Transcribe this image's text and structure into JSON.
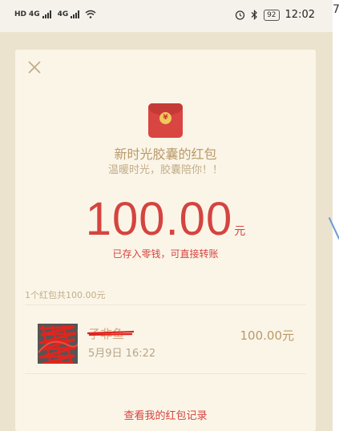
{
  "status_bar": {
    "left_labels": [
      "HD",
      "4G",
      "4G"
    ],
    "battery": "92",
    "time": "12:02"
  },
  "edge": {
    "partial_char": "7"
  },
  "colors": {
    "accent_red": "#d5443f",
    "gold_text": "#b89a6a",
    "card_bg": "#fbf5e8",
    "backdrop": "#ece3cf"
  },
  "icons": {
    "close": "close-icon",
    "packet": "red-packet-icon",
    "coin": "yuan-coin-icon"
  },
  "packet": {
    "coin_symbol": "¥",
    "title": "新时光胶囊的红包",
    "subtitle": "温暖时光，胶囊陪你！！",
    "amount": "100.00",
    "unit": "元",
    "note": "已存入零钱，可直接转账"
  },
  "summary": "1个红包共100.00元",
  "recipients": [
    {
      "name": "子非鱼",
      "time": "5月9日 16:22",
      "amount": "100.00元"
    }
  ],
  "history_link": "查看我的红包记录"
}
